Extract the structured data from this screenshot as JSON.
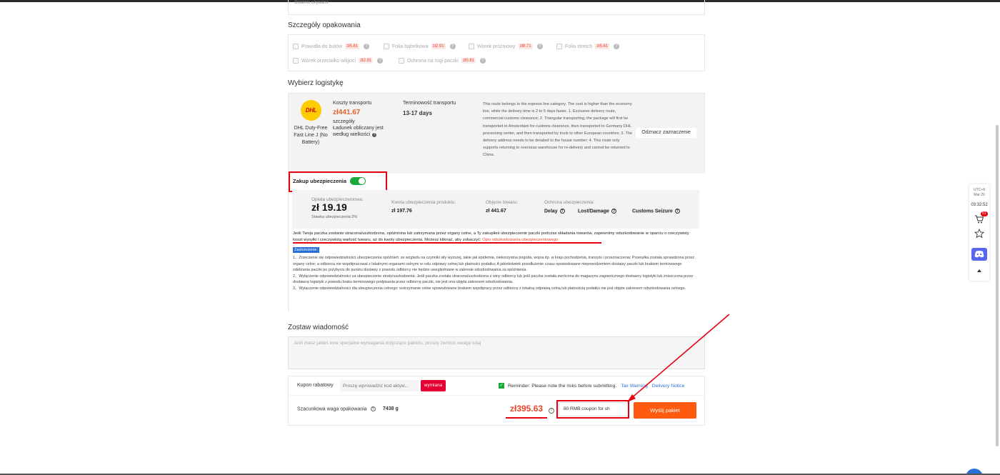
{
  "previous_section": {
    "text": "Ostatnio używane"
  },
  "packaging": {
    "title": "Szczegóły opakowania",
    "options": [
      {
        "label": "Prawidła do butów",
        "price": "zł5.81"
      },
      {
        "label": "Folia bąbelkowa",
        "price": "zł2.91"
      },
      {
        "label": "Worek próżniowy",
        "price": "zł8.71"
      },
      {
        "label": "Folia stretch",
        "price": "zł5.81"
      },
      {
        "label": "Worek przeciwko wilgoci",
        "price": "zł2.91"
      },
      {
        "label": "Ochrona na rogi paczki",
        "price": "zł5.81"
      }
    ]
  },
  "logistics": {
    "title": "Wybierz logistykę",
    "carrier": {
      "logo_text": "DHL",
      "name": "DHL Duty-Free Fast Line J (No Battery)"
    },
    "cost_label": "Koszty transportu",
    "cost_value": "zł441.67",
    "cost_details": "szczegóły",
    "cost_note": "Ładunek obliczany jest według wielkości",
    "time_label": "Terminowość transportu",
    "time_value": "13-17 days",
    "route_description": "This route belongs to the express line category. The cost is higher than the economy line, while the delivery time is 2 to 5 days faster. 1. Exclusive delivery route, commercial customs clearance; 2. Triangular transporting, the package will first be transported to Amsterdam for customs clearance, then transported to Germany DHL processing center, and then transported by truck to other European countries; 3. The delivery address needs to be detailed to the house number; 4. This route only supports returning to overseas warehouse for re-delivery and cannot be returned to China.",
    "unmark_button": "Odznacz zaznaczenie"
  },
  "insurance": {
    "toggle_label": "Zakup ubezpieczenia",
    "toggle_on": true,
    "fee_label": "Opłata ubezpieczeniowa:",
    "fee_value": "zł 19.19",
    "rate_label": "Stawka ubezpieczenia:3%",
    "product_amount_label": "Kwota ubezpieczenia produktu:",
    "product_amount_value": "zł 197.76",
    "coverage_label": "Objęcie towaru:",
    "coverage_value": "zł 441.67",
    "protection_label": "Ochrona ubezpieczenia:",
    "protections": [
      "Delay",
      "Lost/Damage",
      "Customs Seizure"
    ],
    "note": "Jeśli Twoja paczka zostanie utracona/uszkodzona, opóźniona lub zatrzymana przez organy celne, a Ty zakupiłeś ubezpieczenie paczki podczas składania towarów, zapewnimy odszkodowanie w oparciu o rzeczywisty koszt wysyłki i rzeczywistą wartość towaru, aż do kwoty ubezpieczenia. Możesz kliknąć, aby zobaczyć:",
    "note_link": "Opis odszkodowania ubezpieczeniowego",
    "terms_tag": "Zastrzeżenie:",
    "terms": [
      "1、Zrzeczenie się odpowiedzialności ubezpieczenia opóźnień: ze względu na czynniki siły wyższej, takie jak epidemia, niekorzystna pogoda, wojna itp. w kraju pochodzenia, tranzytu i przeznaczenia; Przesyłka została sprawdzona przez organy celne; a odbiorca nie współpracował z lokalnymi organami celnymi w celu odprawy celnej lub płatności podatku; A jakiekolwiek przedłużenie czasu spowodowane niepowodzeniem dostawy paczki lub brakiem terminowego odebrania paczki po przybyciu do punktu dostawy z powodu odbiorcy nie będzie uwzględniane w zakresie odszkodowania za opóźnienia.",
      "2、Wyłączenie odpowiedzialności za ubezpieczenie straty/uszkodzenia: Jeśli paczka została utracona/uszkodzona z winy odbiorcy lub jeśli paczka została zwrócona do magazynu zagranicznego dostawcy logistyki lub zniszczona przez dostawcę logistyki z powodu braku terminowego podpisania przez odbiorcę paczki, nie jest ona objęta zakresem odszkodowania.",
      "3、Wyłączenie odpowiedzialności dla ubezpieczenia celnego: wstrzymanie celne spowodowane brakiem współpracy przez odbiorcę z lokalną odprawą celną lub płatnością podatku nie jest objęte zakresem odszkodowania celnego."
    ]
  },
  "message": {
    "title": "Zostaw wiadomość",
    "placeholder": "Jeśli masz jakieś inne specjalne wymagania dotyczące pakietu, proszę zwrócić uwagę tutaj"
  },
  "checkout": {
    "coupon_label": "Kupon rabatowy",
    "coupon_placeholder": "Proszę wprowadzić kod aktyw...",
    "coupon_button": "wymiana",
    "reminder_text": "Reminder: Please note the risks before submitting.",
    "tax_link": "Tax Warning",
    "delivery_link": "Delivery Notice",
    "weight_label": "Szacunkowa waga opakowania",
    "weight_value": "7438 g",
    "total": "zł395.63",
    "coupon_select": "80 RMB coupon for sh",
    "submit_button": "Wyślij pakiet"
  },
  "side_widget": {
    "timezone": "UTC+8",
    "date": "Mar 20",
    "time": "03:32:52",
    "cart_count": "51",
    "icons": [
      "cart-icon",
      "star-icon",
      "discord-icon",
      "scroll-up-icon"
    ]
  },
  "colors": {
    "accent_orange": "#ff5a0e",
    "price_red": "#e8452c",
    "annotation_red": "#e60012",
    "toggle_green": "#1aaa3a",
    "link_blue": "#2a6fd6"
  }
}
